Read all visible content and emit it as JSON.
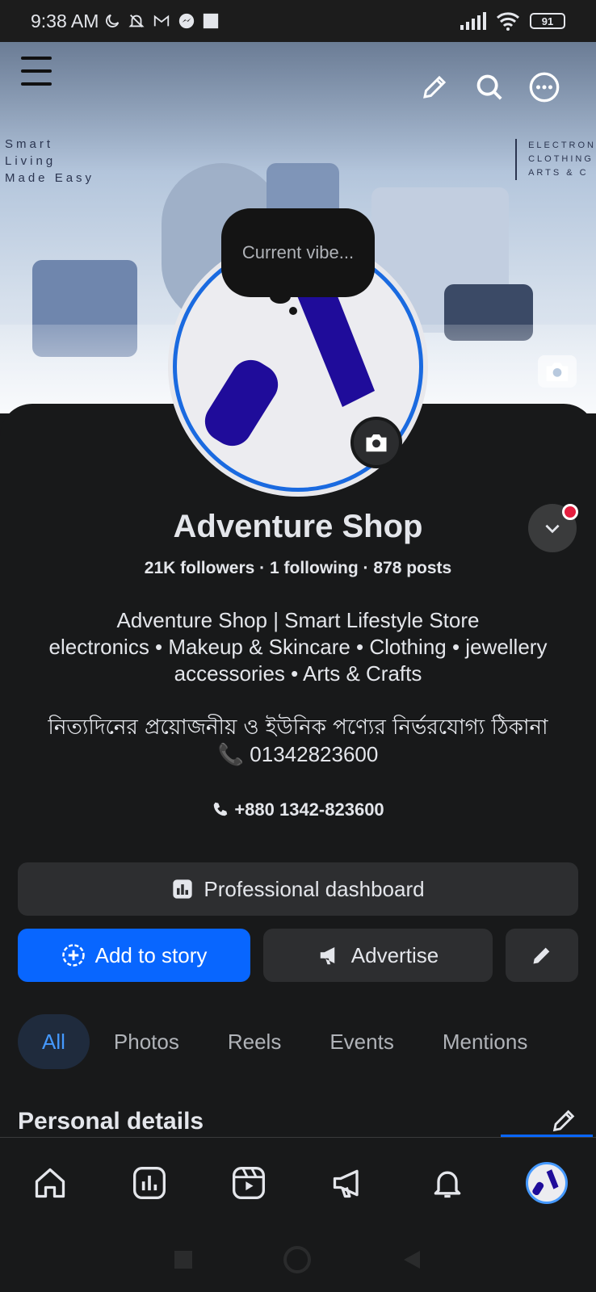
{
  "status_bar": {
    "time": "9:38 AM",
    "battery": "91"
  },
  "cover": {
    "left_text": "Smart\nLiving\nMade Easy",
    "right_text": "ELECTRON\nCLOTHING\nARTS & C"
  },
  "profile": {
    "note_bubble": "Current vibe...",
    "name": "Adventure Shop",
    "followers": "21K followers",
    "following": "1 following",
    "posts": "878 posts",
    "separator": "·"
  },
  "bio": {
    "line1": "Adventure Shop | Smart Lifestyle Store",
    "line2": "electronics • Makeup & Skincare • Clothing • jewellery accessories • Arts & Crafts",
    "line3": "নিত্যদিনের প্রয়োজনীয় ও ইউনিক পণ্যের নির্ভরযোগ্য ঠিকানা",
    "line4": "📞 01342823600"
  },
  "contact": {
    "phone": "+880 1342-823600"
  },
  "buttons": {
    "dashboard": "Professional dashboard",
    "add_story": "Add to story",
    "advertise": "Advertise"
  },
  "tabs": [
    {
      "label": "All",
      "active": true
    },
    {
      "label": "Photos",
      "active": false
    },
    {
      "label": "Reels",
      "active": false
    },
    {
      "label": "Events",
      "active": false
    },
    {
      "label": "Mentions",
      "active": false
    }
  ],
  "section": {
    "title": "Personal details"
  },
  "colors": {
    "accent": "#0866ff",
    "background": "#18191a",
    "surface": "#2d2e30",
    "brand_logo": "#1f0c9a",
    "badge": "#e41e3f"
  },
  "icons": {
    "top_bar": [
      "menu-icon",
      "edit-icon",
      "search-icon",
      "more-icon"
    ],
    "bottom_nav": [
      "home-icon",
      "dashboard-icon",
      "reels-icon",
      "megaphone-icon",
      "bell-icon",
      "profile-avatar"
    ]
  }
}
